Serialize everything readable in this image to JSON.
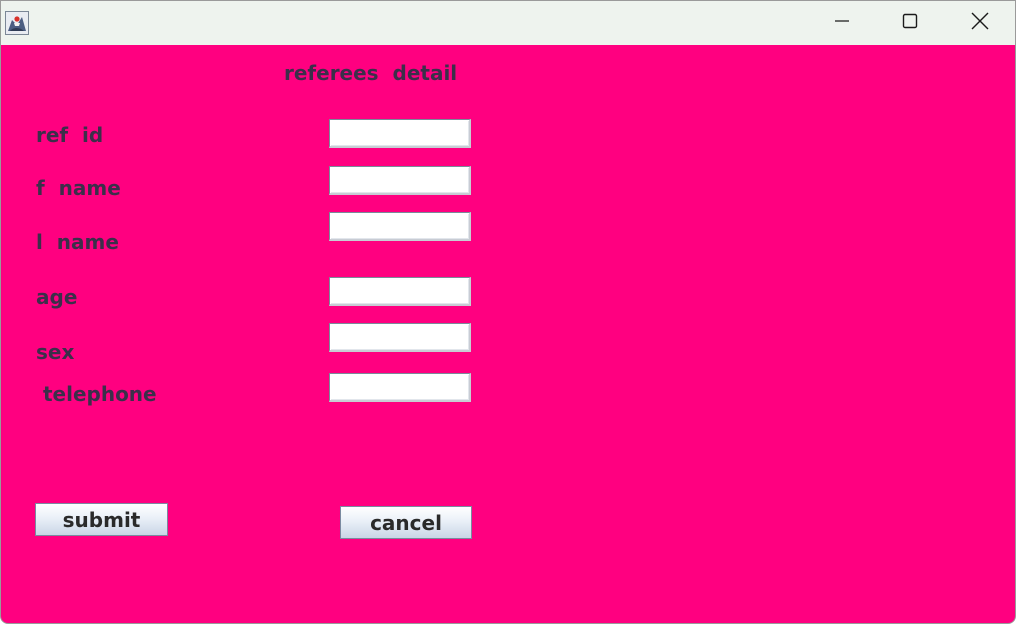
{
  "window": {
    "title": "",
    "controls": {
      "minimize_icon": "minimize-icon",
      "maximize_icon": "maximize-icon",
      "close_icon": "close-icon"
    },
    "background_color": "#ff0080"
  },
  "form": {
    "title": "referees  detail",
    "fields": [
      {
        "label": "ref  id",
        "value": ""
      },
      {
        "label": "f  name",
        "value": ""
      },
      {
        "label": "l  name",
        "value": ""
      },
      {
        "label": "age",
        "value": ""
      },
      {
        "label": "sex",
        "value": ""
      },
      {
        "label": " telephone",
        "value": ""
      }
    ],
    "submit_label": "submit",
    "cancel_label": "cancel"
  }
}
